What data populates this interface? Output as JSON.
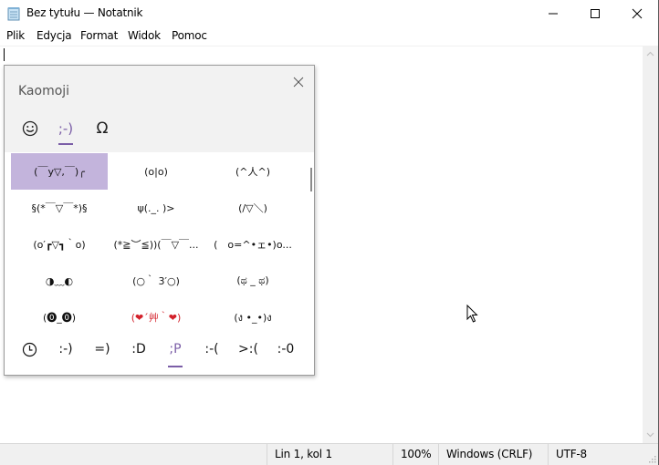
{
  "window": {
    "title": "Bez tytułu — Notatnik",
    "controls": {
      "minimize": "minimize",
      "maximize": "maximize",
      "close": "close"
    }
  },
  "menu": [
    "Plik",
    "Edycja",
    "Format",
    "Widok",
    "Pomoc"
  ],
  "editor": {
    "content": ""
  },
  "statusbar": {
    "position": "Lin 1, kol 1",
    "zoom": "100%",
    "line_ending": "Windows (CRLF)",
    "encoding": "UTF-8"
  },
  "emoji_panel": {
    "title": "Kaomoji",
    "category_tabs": [
      {
        "label": "☺",
        "name": "emoji"
      },
      {
        "label": ";-)",
        "name": "kaomoji",
        "active": true
      },
      {
        "label": "Ω",
        "name": "symbols"
      }
    ],
    "kaomoji": [
      "(￣y▽,￣)╭",
      "(o|o)",
      "(^人^)",
      "§(*￣▽￣*)§",
      "ψ(._. )>",
      "(/▽＼)",
      "(o′┏▽┓｀o)",
      "(*≧︶≦))(￣▽￣...",
      "(　o=^•ェ•)o...",
      "◑﹏◐",
      "(○｀ 3′○)",
      "(ಥ _ ಥ)",
      "(⓿_⓿)",
      "(❤´艸｀❤)",
      "(ง •_•)ง"
    ],
    "selected_index": 0,
    "sub_tabs": [
      {
        "label": "🕓",
        "name": "recent"
      },
      {
        "label": ":-)",
        "name": "happy"
      },
      {
        "label": "=)",
        "name": "greeting"
      },
      {
        "label": ":D",
        "name": "laughing"
      },
      {
        "label": ";P",
        "name": "wink",
        "active": true
      },
      {
        "label": ":-(",
        "name": "sad"
      },
      {
        "label": ">:(",
        "name": "angry"
      },
      {
        "label": ":-0",
        "name": "surprised"
      }
    ],
    "accent_color": "#7b5ea7",
    "selected_color": "#c3b4dc"
  }
}
